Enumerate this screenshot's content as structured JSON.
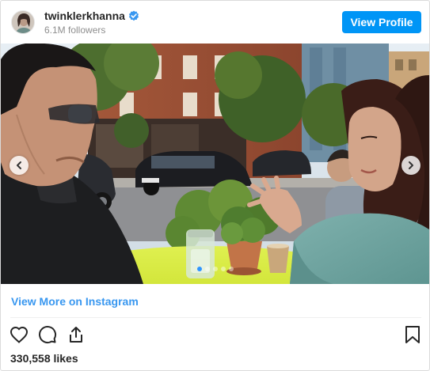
{
  "header": {
    "username": "twinklerkhanna",
    "followers": "6.1M followers",
    "view_profile_label": "View Profile"
  },
  "post": {
    "carousel": {
      "slide_count": 5,
      "active_slide": 1
    }
  },
  "footer": {
    "view_more_label": "View More on Instagram",
    "likes": "330,558 likes"
  },
  "icons": {
    "verified": "verified-badge-icon",
    "prev": "chevron-left-icon",
    "next": "chevron-right-icon",
    "like": "heart-icon",
    "comment": "comment-icon",
    "share": "share-icon",
    "save": "bookmark-icon"
  },
  "colors": {
    "accent": "#0095f6",
    "link": "#3897f0",
    "verified": "#3897f0",
    "text": "#262626",
    "muted": "#8e8e8e"
  }
}
